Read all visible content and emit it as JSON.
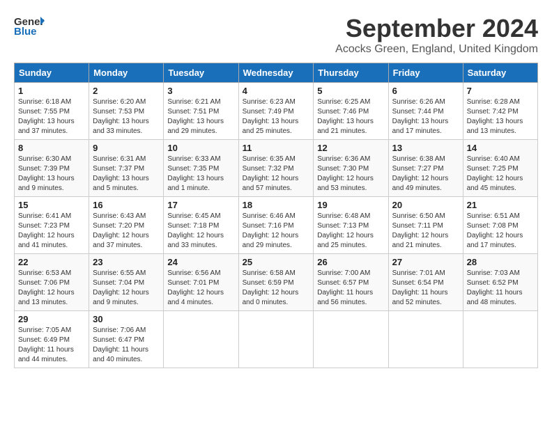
{
  "header": {
    "logo_line1": "General",
    "logo_line2": "Blue",
    "month_title": "September 2024",
    "location": "Acocks Green, England, United Kingdom"
  },
  "weekdays": [
    "Sunday",
    "Monday",
    "Tuesday",
    "Wednesday",
    "Thursday",
    "Friday",
    "Saturday"
  ],
  "weeks": [
    [
      {
        "day": "1",
        "sunrise": "6:18 AM",
        "sunset": "7:55 PM",
        "daylight": "13 hours and 37 minutes."
      },
      {
        "day": "2",
        "sunrise": "6:20 AM",
        "sunset": "7:53 PM",
        "daylight": "13 hours and 33 minutes."
      },
      {
        "day": "3",
        "sunrise": "6:21 AM",
        "sunset": "7:51 PM",
        "daylight": "13 hours and 29 minutes."
      },
      {
        "day": "4",
        "sunrise": "6:23 AM",
        "sunset": "7:49 PM",
        "daylight": "13 hours and 25 minutes."
      },
      {
        "day": "5",
        "sunrise": "6:25 AM",
        "sunset": "7:46 PM",
        "daylight": "13 hours and 21 minutes."
      },
      {
        "day": "6",
        "sunrise": "6:26 AM",
        "sunset": "7:44 PM",
        "daylight": "13 hours and 17 minutes."
      },
      {
        "day": "7",
        "sunrise": "6:28 AM",
        "sunset": "7:42 PM",
        "daylight": "13 hours and 13 minutes."
      }
    ],
    [
      {
        "day": "8",
        "sunrise": "6:30 AM",
        "sunset": "7:39 PM",
        "daylight": "13 hours and 9 minutes."
      },
      {
        "day": "9",
        "sunrise": "6:31 AM",
        "sunset": "7:37 PM",
        "daylight": "13 hours and 5 minutes."
      },
      {
        "day": "10",
        "sunrise": "6:33 AM",
        "sunset": "7:35 PM",
        "daylight": "13 hours and 1 minute."
      },
      {
        "day": "11",
        "sunrise": "6:35 AM",
        "sunset": "7:32 PM",
        "daylight": "12 hours and 57 minutes."
      },
      {
        "day": "12",
        "sunrise": "6:36 AM",
        "sunset": "7:30 PM",
        "daylight": "12 hours and 53 minutes."
      },
      {
        "day": "13",
        "sunrise": "6:38 AM",
        "sunset": "7:27 PM",
        "daylight": "12 hours and 49 minutes."
      },
      {
        "day": "14",
        "sunrise": "6:40 AM",
        "sunset": "7:25 PM",
        "daylight": "12 hours and 45 minutes."
      }
    ],
    [
      {
        "day": "15",
        "sunrise": "6:41 AM",
        "sunset": "7:23 PM",
        "daylight": "12 hours and 41 minutes."
      },
      {
        "day": "16",
        "sunrise": "6:43 AM",
        "sunset": "7:20 PM",
        "daylight": "12 hours and 37 minutes."
      },
      {
        "day": "17",
        "sunrise": "6:45 AM",
        "sunset": "7:18 PM",
        "daylight": "12 hours and 33 minutes."
      },
      {
        "day": "18",
        "sunrise": "6:46 AM",
        "sunset": "7:16 PM",
        "daylight": "12 hours and 29 minutes."
      },
      {
        "day": "19",
        "sunrise": "6:48 AM",
        "sunset": "7:13 PM",
        "daylight": "12 hours and 25 minutes."
      },
      {
        "day": "20",
        "sunrise": "6:50 AM",
        "sunset": "7:11 PM",
        "daylight": "12 hours and 21 minutes."
      },
      {
        "day": "21",
        "sunrise": "6:51 AM",
        "sunset": "7:08 PM",
        "daylight": "12 hours and 17 minutes."
      }
    ],
    [
      {
        "day": "22",
        "sunrise": "6:53 AM",
        "sunset": "7:06 PM",
        "daylight": "12 hours and 13 minutes."
      },
      {
        "day": "23",
        "sunrise": "6:55 AM",
        "sunset": "7:04 PM",
        "daylight": "12 hours and 9 minutes."
      },
      {
        "day": "24",
        "sunrise": "6:56 AM",
        "sunset": "7:01 PM",
        "daylight": "12 hours and 4 minutes."
      },
      {
        "day": "25",
        "sunrise": "6:58 AM",
        "sunset": "6:59 PM",
        "daylight": "12 hours and 0 minutes."
      },
      {
        "day": "26",
        "sunrise": "7:00 AM",
        "sunset": "6:57 PM",
        "daylight": "11 hours and 56 minutes."
      },
      {
        "day": "27",
        "sunrise": "7:01 AM",
        "sunset": "6:54 PM",
        "daylight": "11 hours and 52 minutes."
      },
      {
        "day": "28",
        "sunrise": "7:03 AM",
        "sunset": "6:52 PM",
        "daylight": "11 hours and 48 minutes."
      }
    ],
    [
      {
        "day": "29",
        "sunrise": "7:05 AM",
        "sunset": "6:49 PM",
        "daylight": "11 hours and 44 minutes."
      },
      {
        "day": "30",
        "sunrise": "7:06 AM",
        "sunset": "6:47 PM",
        "daylight": "11 hours and 40 minutes."
      },
      null,
      null,
      null,
      null,
      null
    ]
  ]
}
